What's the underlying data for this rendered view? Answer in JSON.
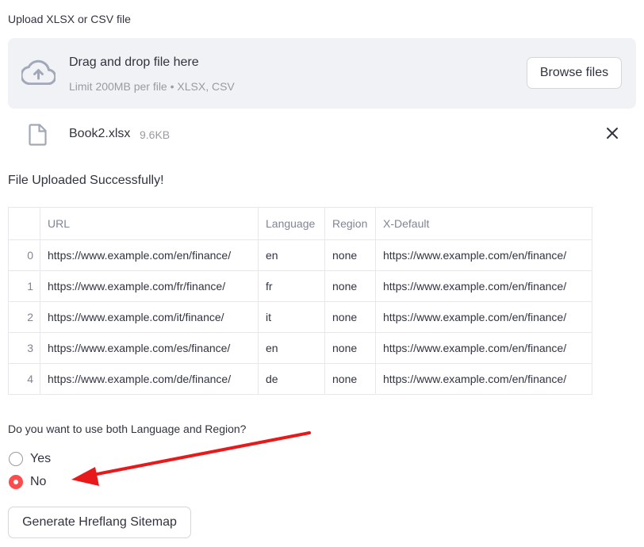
{
  "uploader": {
    "label": "Upload XLSX or CSV file",
    "drop_title": "Drag and drop file here",
    "limit_text": "Limit 200MB per file • XLSX, CSV",
    "browse_label": "Browse files",
    "icon": "cloud-upload-icon"
  },
  "uploaded_file": {
    "name": "Book2.xlsx",
    "size": "9.6KB",
    "icon": "file-icon"
  },
  "status_message": "File Uploaded Successfully!",
  "table": {
    "columns": [
      "",
      "URL",
      "Language",
      "Region",
      "X-Default"
    ],
    "rows": [
      {
        "index": "0",
        "url": "https://www.example.com/en/finance/",
        "language": "en",
        "region": "none",
        "xdefault": "https://www.example.com/en/finance/"
      },
      {
        "index": "1",
        "url": "https://www.example.com/fr/finance/",
        "language": "fr",
        "region": "none",
        "xdefault": "https://www.example.com/en/finance/"
      },
      {
        "index": "2",
        "url": "https://www.example.com/it/finance/",
        "language": "it",
        "region": "none",
        "xdefault": "https://www.example.com/en/finance/"
      },
      {
        "index": "3",
        "url": "https://www.example.com/es/finance/",
        "language": "en",
        "region": "none",
        "xdefault": "https://www.example.com/en/finance/"
      },
      {
        "index": "4",
        "url": "https://www.example.com/de/finance/",
        "language": "de",
        "region": "none",
        "xdefault": "https://www.example.com/en/finance/"
      }
    ]
  },
  "question": {
    "label": "Do you want to use both Language and Region?",
    "options": [
      {
        "label": "Yes",
        "selected": false
      },
      {
        "label": "No",
        "selected": true
      }
    ]
  },
  "generate_button": "Generate Hreflang Sitemap",
  "colors": {
    "accent": "#ff4b4b",
    "dropzone_bg": "#f0f2f6",
    "annotation_arrow": "#e8191a"
  }
}
